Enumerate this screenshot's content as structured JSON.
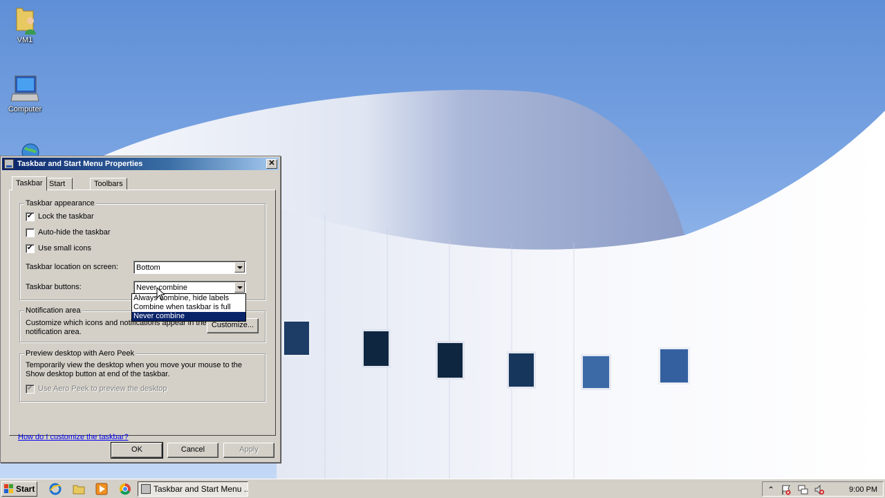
{
  "desktop": {
    "icons": [
      {
        "label": "VM1",
        "icon": "user-folder-icon"
      },
      {
        "label": "Computer",
        "icon": "computer-icon"
      },
      {
        "label": "",
        "icon": "network-globe-icon"
      }
    ]
  },
  "dialog": {
    "title": "Taskbar and Start Menu Properties",
    "close_label": "✕",
    "tabs": [
      {
        "label": "Taskbar",
        "active": true
      },
      {
        "label": "Start Menu",
        "active": false
      },
      {
        "label": "Toolbars",
        "active": false
      }
    ],
    "appearance": {
      "group_title": "Taskbar appearance",
      "lock_taskbar": {
        "label": "Lock the taskbar",
        "checked": true
      },
      "auto_hide": {
        "label": "Auto-hide the taskbar",
        "checked": false
      },
      "small_icons": {
        "label": "Use small icons",
        "checked": true
      },
      "location_label": "Taskbar location on screen:",
      "location_value": "Bottom",
      "buttons_label": "Taskbar buttons:",
      "buttons_value": "Never combine",
      "buttons_options": [
        "Always combine, hide labels",
        "Combine when taskbar is full",
        "Never combine"
      ],
      "buttons_selected_index": 2
    },
    "notification": {
      "group_title": "Notification area",
      "description_line1": "Customize which icons and notifications appear in the",
      "description_line2": "notification area.",
      "customize_label": "Customize..."
    },
    "aero_peek": {
      "group_title": "Preview desktop with Aero Peek",
      "description_line1": "Temporarily view the desktop when you move your mouse to the",
      "description_line2": "Show desktop button at end of the taskbar.",
      "checkbox": {
        "label": "Use Aero Peek to preview the desktop",
        "checked": true,
        "disabled": true
      }
    },
    "help_link": "How do I customize the taskbar?",
    "buttons": {
      "ok": "OK",
      "cancel": "Cancel",
      "apply": "Apply"
    }
  },
  "taskbar": {
    "start_label": "Start",
    "quick_launch": [
      "ie-icon",
      "explorer-folder-icon",
      "media-player-icon",
      "chrome-icon"
    ],
    "task_button_label": "Taskbar and Start Menu ...",
    "tray_icons": [
      "show-hidden-chevron-icon",
      "action-center-flag-icon",
      "network-icon",
      "volume-muted-icon"
    ],
    "show_hidden_glyph": "⌃",
    "clock": "9:00 PM"
  },
  "colors": {
    "dialog_face": "#d4d0c8",
    "title_active_start": "#0a246a",
    "title_active_end": "#a6caf0",
    "selection": "#0a246a",
    "link": "#0000ee"
  }
}
